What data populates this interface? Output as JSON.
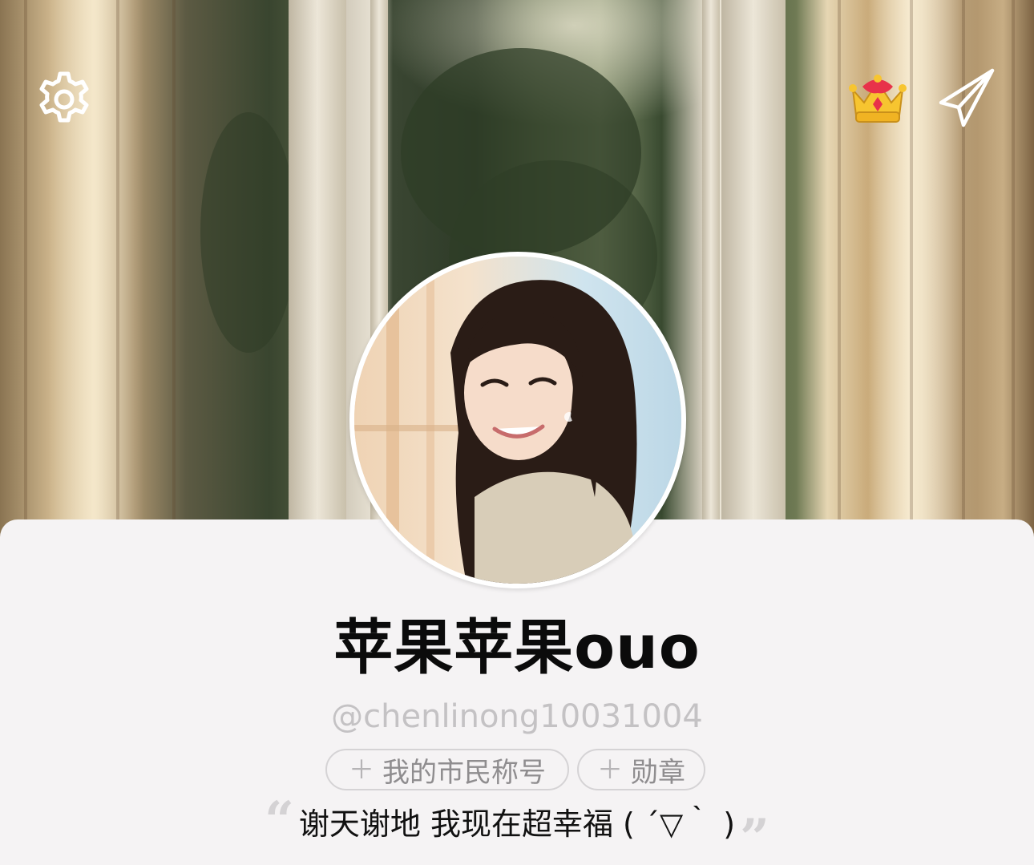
{
  "header": {
    "settings_icon": "gear-icon",
    "crown_icon": "crown-icon",
    "share_icon": "paper-plane-icon"
  },
  "profile": {
    "display_name": "苹果苹果ouo",
    "handle": "@chenlinong10031004",
    "chips": [
      {
        "label": "我的市民称号",
        "icon": "plus-icon"
      },
      {
        "label": "勋章",
        "icon": "plus-icon"
      }
    ],
    "bio": "谢天谢地 我现在超幸福 ( ´▽｀ )",
    "quote_open": "“",
    "quote_close": "”"
  },
  "colors": {
    "sheet_background": "#f5f3f4",
    "name_text": "#0b0b0b",
    "handle_text": "#c4c2c4",
    "chip_border": "#d5d3d5",
    "chip_text": "#8f8d8f"
  }
}
